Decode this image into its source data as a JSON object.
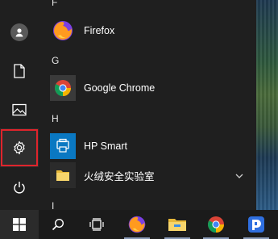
{
  "start_menu": {
    "groups": [
      {
        "letter": "F",
        "apps": [
          {
            "label": "Firefox",
            "icon": "firefox-icon"
          }
        ]
      },
      {
        "letter": "G",
        "apps": [
          {
            "label": "Google Chrome",
            "icon": "chrome-icon"
          }
        ]
      },
      {
        "letter": "H",
        "apps": [
          {
            "label": "HP Smart",
            "icon": "hp-smart-icon"
          },
          {
            "label": "火绒安全实验室",
            "icon": "folder-icon",
            "expandable": true
          }
        ]
      },
      {
        "letter": "I",
        "apps": []
      }
    ],
    "rail": [
      "user-icon",
      "documents-icon",
      "pictures-icon",
      "settings-icon",
      "power-icon"
    ],
    "selected_rail_item": "settings-icon"
  },
  "taskbar": {
    "items": [
      "start-windows-icon",
      "search-icon",
      "task-view-icon",
      "firefox-icon",
      "file-explorer-icon",
      "chrome-icon",
      "app-icon"
    ]
  },
  "colors": {
    "menu_background": "#1f1f1f",
    "taskbar_background": "#1b1b1b",
    "selection_outline": "#e0242c",
    "hp_smart_tile": "#0a78c2",
    "folder_tile": "#2b2b2b",
    "chrome_tile": "#3a3a3a"
  }
}
